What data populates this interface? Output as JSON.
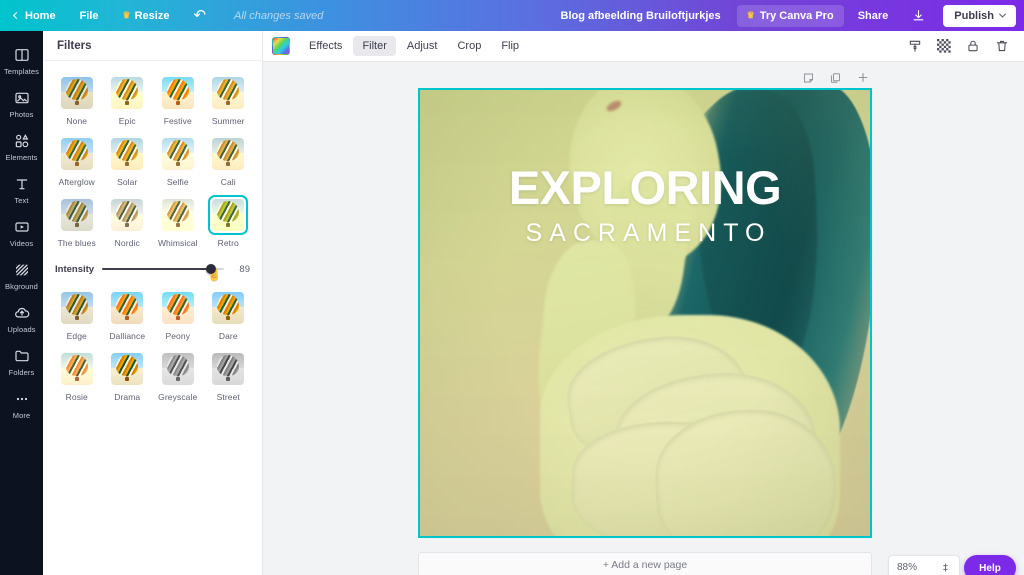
{
  "topbar": {
    "home_label": "Home",
    "file_label": "File",
    "resize_label": "Resize",
    "undo_icon": "undo-icon",
    "saved_status": "All changes saved",
    "doc_title": "Blog afbeelding Bruiloftjurkjes",
    "pro_label": "Try Canva Pro",
    "share_label": "Share",
    "download_icon": "download-icon",
    "publish_label": "Publish",
    "gradient_start": "#00c4cc",
    "gradient_end": "#7d2ae8"
  },
  "rail": {
    "items": [
      {
        "label": "Templates",
        "icon": "templates-icon"
      },
      {
        "label": "Photos",
        "icon": "photos-icon"
      },
      {
        "label": "Elements",
        "icon": "elements-icon"
      },
      {
        "label": "Text",
        "icon": "text-icon"
      },
      {
        "label": "Videos",
        "icon": "videos-icon"
      },
      {
        "label": "Bkground",
        "icon": "background-icon"
      },
      {
        "label": "Uploads",
        "icon": "uploads-icon"
      },
      {
        "label": "Folders",
        "icon": "folders-icon"
      },
      {
        "label": "More",
        "icon": "more-icon"
      }
    ]
  },
  "panel": {
    "title": "Filters",
    "selected_filter": "Retro",
    "selection_color": "#00c4cc",
    "filters": [
      {
        "name": "None"
      },
      {
        "name": "Epic"
      },
      {
        "name": "Festive"
      },
      {
        "name": "Summer"
      },
      {
        "name": "Afterglow"
      },
      {
        "name": "Solar"
      },
      {
        "name": "Selfie"
      },
      {
        "name": "Cali"
      },
      {
        "name": "The blues"
      },
      {
        "name": "Nordic"
      },
      {
        "name": "Whimsical"
      },
      {
        "name": "Retro"
      },
      {
        "name": "Edge"
      },
      {
        "name": "Dalliance"
      },
      {
        "name": "Peony"
      },
      {
        "name": "Dare"
      },
      {
        "name": "Rosie"
      },
      {
        "name": "Drama"
      },
      {
        "name": "Greyscale"
      },
      {
        "name": "Street"
      }
    ],
    "intensity": {
      "label": "Intensity",
      "value": "89",
      "percent": 89
    }
  },
  "editbar": {
    "swatch_icon": "rainbow-swatch-icon",
    "tabs": [
      {
        "label": "Effects",
        "active": false
      },
      {
        "label": "Filter",
        "active": true
      },
      {
        "label": "Adjust",
        "active": false
      },
      {
        "label": "Crop",
        "active": false
      },
      {
        "label": "Flip",
        "active": false
      }
    ],
    "right_icons": [
      {
        "name": "copy-style-icon"
      },
      {
        "name": "transparency-icon"
      },
      {
        "name": "lock-icon"
      },
      {
        "name": "delete-icon"
      }
    ]
  },
  "canvas": {
    "page_tools": [
      {
        "name": "notes-icon"
      },
      {
        "name": "duplicate-page-icon"
      },
      {
        "name": "add-page-icon"
      }
    ],
    "rotate_icon": "rotate-icon",
    "overlay_title": "EXPLORING",
    "overlay_subtitle": "SACRAMENTO",
    "border_color": "#00c4cc"
  },
  "footer": {
    "add_page_label": "+ Add a new page",
    "zoom_value": "88%",
    "help_label": "Help"
  }
}
